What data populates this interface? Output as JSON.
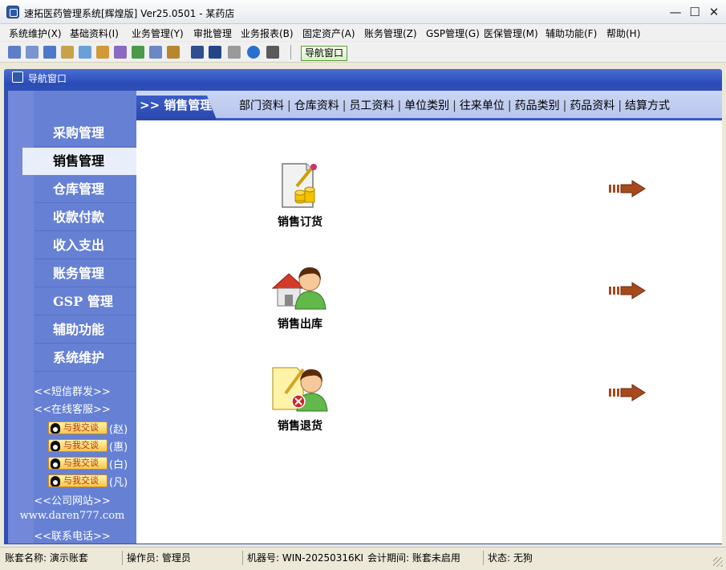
{
  "window": {
    "title": "速拓医药管理系统[辉煌版] Ver25.0501  -  某药店",
    "minimize": "—",
    "maximize": "☐",
    "close": "✕"
  },
  "menu": [
    "系统维护(X)",
    "基础资料(I)",
    "业务管理(Y)",
    "审批管理",
    "业务报表(B)",
    "固定资产(A)",
    "账务管理(Z)",
    "GSP管理(G)",
    "医保管理(M)",
    "辅助功能(F)",
    "帮助(H)"
  ],
  "toolbar": {
    "nav_button": "导航窗口"
  },
  "inner_window": {
    "title": "导航窗口"
  },
  "sidebar": {
    "items": [
      "采购管理",
      "销售管理",
      "仓库管理",
      "收款付款",
      "收入支出",
      "账务管理",
      "GSP 管理",
      "辅助功能",
      "系统维护"
    ],
    "active_index": 1,
    "links": {
      "sms": "<<短信群发>>",
      "online": "<<在线客服>>",
      "website": "<<公司网站>>",
      "url": "www.daren777.com",
      "phone": "<<联系电话>>"
    },
    "qq_badge": "与我交谈",
    "qq_contacts": [
      "(赵)",
      "(惠)",
      "(白)",
      "(凡)"
    ]
  },
  "main": {
    "section": ">> 销售管理",
    "links": [
      "部门资料",
      "仓库资料",
      "员工资料",
      "单位类别",
      "往来单位",
      "药品类别",
      "药品资料",
      "结算方式"
    ],
    "functions": [
      "销售订货",
      "销售出库",
      "销售退货"
    ]
  },
  "status": {
    "account": "账套名称: 演示账套",
    "operator": "操作员: 管理员",
    "machine": "机器号: WIN-20250316KI",
    "period": "会计期间: 账套未启用",
    "state": "状态: 无狗"
  },
  "colors": {
    "sidebar_bg": "#6680d4",
    "header_bg": "#c3cff1",
    "section_tab": "#2f4fb8",
    "arrow": "#a64a1e"
  }
}
